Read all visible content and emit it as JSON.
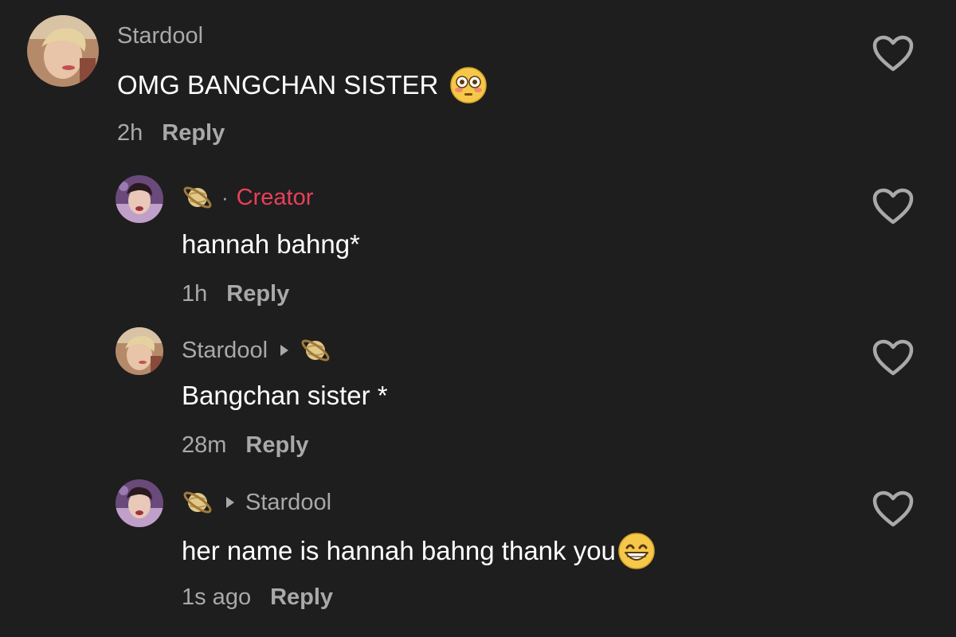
{
  "comments": [
    {
      "username": "Stardool",
      "text": "OMG BANGCHAN SISTER",
      "emoji": "flushed-face",
      "time": "2h",
      "reply_label": "Reply"
    },
    {
      "username_icon": "ringed-planet",
      "tag": "Creator",
      "separator": "·",
      "text": "hannah bahng*",
      "time": "1h",
      "reply_label": "Reply"
    },
    {
      "username": "Stardool",
      "reply_to_icon": "ringed-planet",
      "text": "Bangchan sister *",
      "time": "28m",
      "reply_label": "Reply"
    },
    {
      "username_icon": "ringed-planet",
      "reply_to": "Stardool",
      "text": "her name is hannah bahng thank you",
      "emoji": "grinning-face",
      "time": "1s ago",
      "reply_label": "Reply"
    }
  ],
  "colors": {
    "background": "#1e1e1e",
    "text": "#ffffff",
    "secondary": "#a9a9a9",
    "creator": "#e8405a"
  }
}
